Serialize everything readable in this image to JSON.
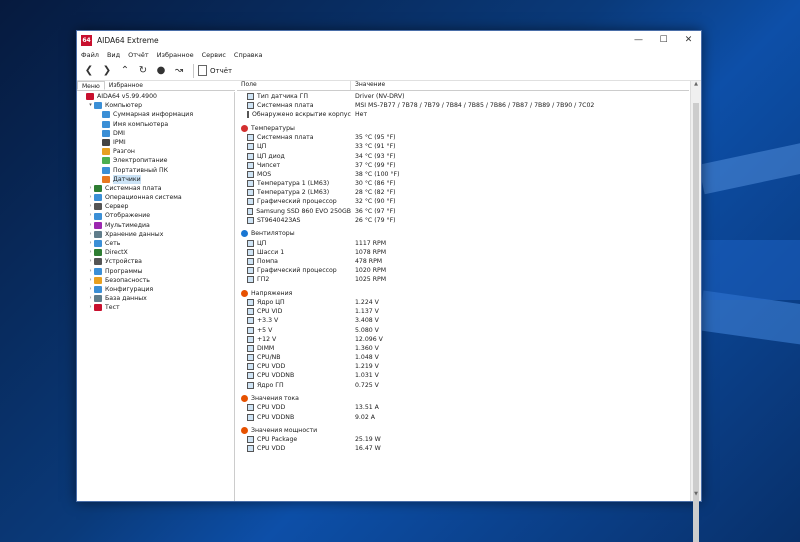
{
  "window": {
    "title": "AIDA64 Extreme",
    "app_icon_text": "64"
  },
  "menu": [
    "Файл",
    "Вид",
    "Отчёт",
    "Избранное",
    "Сервис",
    "Справка"
  ],
  "toolbar": {
    "report_label": "Отчёт"
  },
  "left_tabs": [
    "Меню",
    "Избранное"
  ],
  "tree": [
    {
      "label": "AIDA64 v5.99.4900",
      "indent": 0,
      "exp": "",
      "color": "#c8102e"
    },
    {
      "label": "Компьютер",
      "indent": 1,
      "exp": "v",
      "color": "#3b8fd6"
    },
    {
      "label": "Суммарная информация",
      "indent": 2,
      "exp": "",
      "color": "#3b8fd6"
    },
    {
      "label": "Имя компьютера",
      "indent": 2,
      "exp": "",
      "color": "#3b8fd6"
    },
    {
      "label": "DMI",
      "indent": 2,
      "exp": "",
      "color": "#3b8fd6"
    },
    {
      "label": "IPMI",
      "indent": 2,
      "exp": "",
      "color": "#444444"
    },
    {
      "label": "Разгон",
      "indent": 2,
      "exp": "",
      "color": "#e8a020"
    },
    {
      "label": "Электропитание",
      "indent": 2,
      "exp": "",
      "color": "#4caf50"
    },
    {
      "label": "Портативный ПК",
      "indent": 2,
      "exp": "",
      "color": "#3b8fd6"
    },
    {
      "label": "Датчики",
      "indent": 2,
      "exp": "",
      "color": "#e87820",
      "selected": true
    },
    {
      "label": "Системная плата",
      "indent": 1,
      "exp": ">",
      "color": "#2e7d32"
    },
    {
      "label": "Операционная система",
      "indent": 1,
      "exp": ">",
      "color": "#3b8fd6"
    },
    {
      "label": "Сервер",
      "indent": 1,
      "exp": ">",
      "color": "#555555"
    },
    {
      "label": "Отображение",
      "indent": 1,
      "exp": ">",
      "color": "#3b8fd6"
    },
    {
      "label": "Мультимедиа",
      "indent": 1,
      "exp": ">",
      "color": "#9c27b0"
    },
    {
      "label": "Хранение данных",
      "indent": 1,
      "exp": ">",
      "color": "#607d8b"
    },
    {
      "label": "Сеть",
      "indent": 1,
      "exp": ">",
      "color": "#3b8fd6"
    },
    {
      "label": "DirectX",
      "indent": 1,
      "exp": ">",
      "color": "#2e7d32"
    },
    {
      "label": "Устройства",
      "indent": 1,
      "exp": ">",
      "color": "#555555"
    },
    {
      "label": "Программы",
      "indent": 1,
      "exp": ">",
      "color": "#3b8fd6"
    },
    {
      "label": "Безопасность",
      "indent": 1,
      "exp": ">",
      "color": "#e8a020"
    },
    {
      "label": "Конфигурация",
      "indent": 1,
      "exp": ">",
      "color": "#3b8fd6"
    },
    {
      "label": "База данных",
      "indent": 1,
      "exp": ">",
      "color": "#607d8b"
    },
    {
      "label": "Тест",
      "indent": 1,
      "exp": ">",
      "color": "#c8102e"
    }
  ],
  "columns": {
    "field": "Поле",
    "value": "Значение"
  },
  "sections": [
    {
      "title": "",
      "icon_color": "",
      "rows": [
        {
          "field": "Тип датчика ГП",
          "value": "Driver  (NV-DRV)"
        },
        {
          "field": "Системная плата",
          "value": "MSI MS-7B77 / 7B78 / 7B79 / 7B84 / 7B85 / 7B86 / 7B87 / 7B89 / 7B90 / 7C02"
        },
        {
          "field": "Обнаружено вскрытие корпуса",
          "value": "Нет"
        }
      ]
    },
    {
      "title": "Температуры",
      "icon_color": "#d32f2f",
      "rows": [
        {
          "field": "Системная плата",
          "value": "35 °C  (95 °F)"
        },
        {
          "field": "ЦП",
          "value": "33 °C  (91 °F)"
        },
        {
          "field": "ЦП диод",
          "value": "34 °C  (93 °F)"
        },
        {
          "field": "Чипсет",
          "value": "37 °C  (99 °F)"
        },
        {
          "field": "MOS",
          "value": "38 °C  (100 °F)"
        },
        {
          "field": "Температура 1 (LM63)",
          "value": "30 °C  (86 °F)"
        },
        {
          "field": "Температура 2 (LM63)",
          "value": "28 °C  (82 °F)"
        },
        {
          "field": "Графический процессор",
          "value": "32 °C  (90 °F)"
        },
        {
          "field": "Samsung SSD 860 EVO 250GB",
          "value": "36 °C  (97 °F)"
        },
        {
          "field": "ST9640423AS",
          "value": "26 °C  (79 °F)"
        }
      ]
    },
    {
      "title": "Вентиляторы",
      "icon_color": "#1976d2",
      "rows": [
        {
          "field": "ЦП",
          "value": "1117 RPM"
        },
        {
          "field": "Шасси 1",
          "value": "1078 RPM"
        },
        {
          "field": "Помпа",
          "value": "478 RPM"
        },
        {
          "field": "Графический процессор",
          "value": "1020 RPM"
        },
        {
          "field": "ГП2",
          "value": "1025 RPM"
        }
      ]
    },
    {
      "title": "Напряжения",
      "icon_color": "#e65100",
      "rows": [
        {
          "field": "Ядро ЦП",
          "value": "1.224 V"
        },
        {
          "field": "CPU VID",
          "value": "1.137 V"
        },
        {
          "field": "+3.3 V",
          "value": "3.408 V"
        },
        {
          "field": "+5 V",
          "value": "5.080 V"
        },
        {
          "field": "+12 V",
          "value": "12.096 V"
        },
        {
          "field": "DIMM",
          "value": "1.360 V"
        },
        {
          "field": "CPU/NB",
          "value": "1.048 V"
        },
        {
          "field": "CPU VDD",
          "value": "1.219 V"
        },
        {
          "field": "CPU VDDNB",
          "value": "1.031 V"
        },
        {
          "field": "Ядро ГП",
          "value": "0.725 V"
        }
      ]
    },
    {
      "title": "Значения тока",
      "icon_color": "#e65100",
      "rows": [
        {
          "field": "CPU VDD",
          "value": "13.51 A"
        },
        {
          "field": "CPU VDDNB",
          "value": "9.02 A"
        }
      ]
    },
    {
      "title": "Значения мощности",
      "icon_color": "#e65100",
      "rows": [
        {
          "field": "CPU Package",
          "value": "25.19 W"
        },
        {
          "field": "CPU VDD",
          "value": "16.47 W"
        }
      ]
    }
  ]
}
